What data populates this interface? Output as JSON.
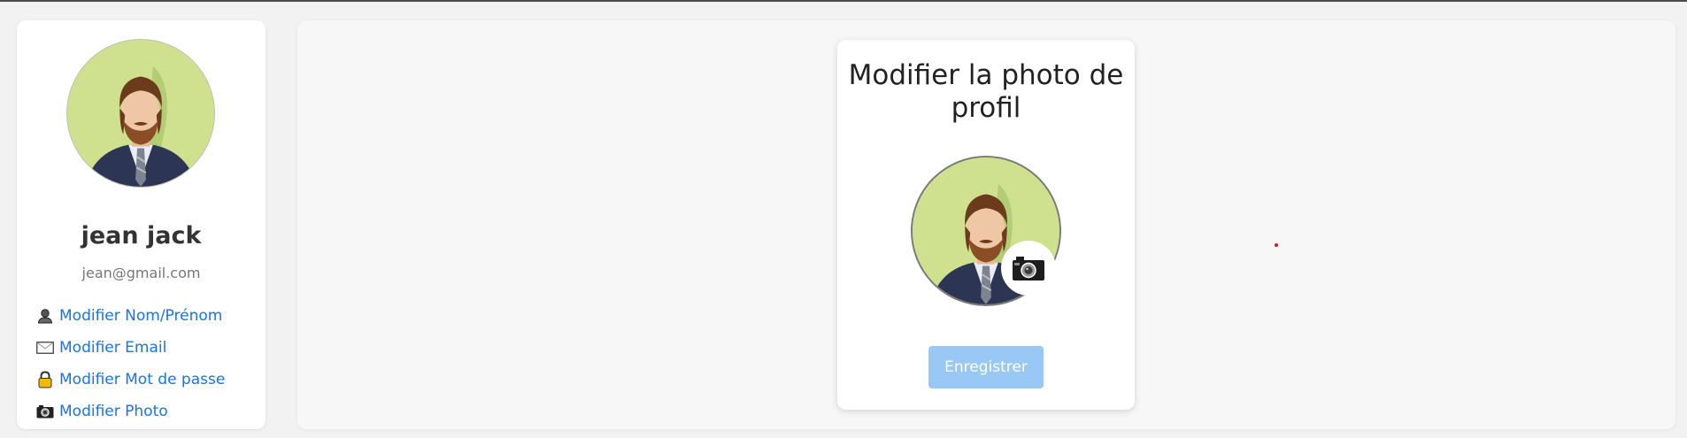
{
  "sidebar": {
    "user": {
      "name": "jean jack",
      "email": "jean@gmail.com",
      "avatar_icon": "profile-avatar-icon"
    },
    "menu": [
      {
        "label": "Modifier Nom/Prénom",
        "icon": "user-icon"
      },
      {
        "label": "Modifier Email",
        "icon": "envelope-icon"
      },
      {
        "label": "Modifier Mot de passe",
        "icon": "lock-icon"
      },
      {
        "label": "Modifier Photo",
        "icon": "camera-icon"
      }
    ]
  },
  "card": {
    "title": "Modifier la photo de profil",
    "save_label": "Enregistrer",
    "camera_icon": "camera-icon"
  },
  "colors": {
    "link": "#1a73e8",
    "button_disabled": "#99c8f5",
    "avatar_background": "#cfe08f"
  }
}
